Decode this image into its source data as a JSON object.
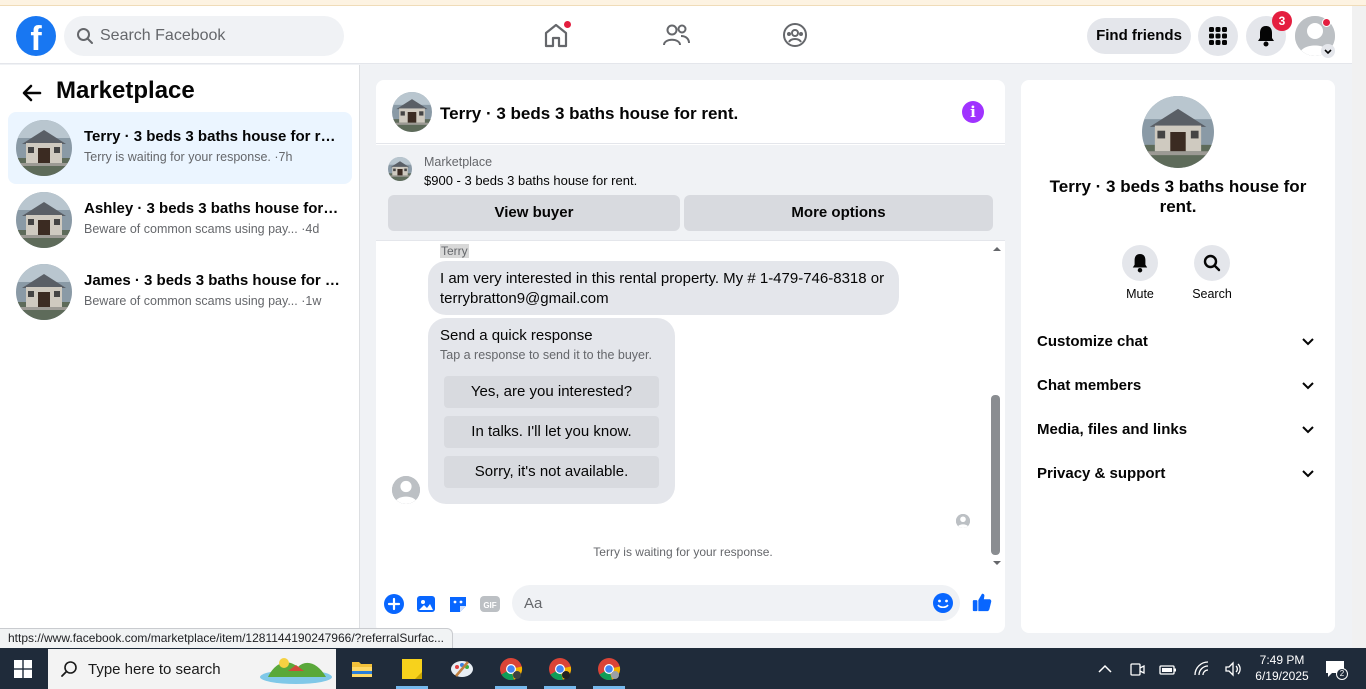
{
  "topbar": {
    "search_placeholder": "Search Facebook",
    "find_friends": "Find friends",
    "notification_count": "3"
  },
  "sidebar": {
    "title": "Marketplace",
    "conversations": [
      {
        "name": "Terry · 3 beds 3 baths house for re...",
        "preview": "Terry is waiting for your response.",
        "time": "·7h"
      },
      {
        "name": "Ashley · 3 beds 3 baths house for r...",
        "preview": "Beware of common scams using pay...",
        "time": "·4d"
      },
      {
        "name": "James · 3 beds 3 baths house for r...",
        "preview": "Beware of common scams using pay...",
        "time": "·1w"
      }
    ]
  },
  "chat": {
    "title": "Terry · 3 beds 3 baths house for rent.",
    "listing_label": "Marketplace",
    "listing_price": "$900 - 3 beds 3 baths house for rent.",
    "view_buyer": "View buyer",
    "more_options": "More options",
    "sender": "Terry",
    "message": "I am very interested in this rental property. My # 1-479-746-8318 or terrybratton9@gmail.com",
    "quick_response": {
      "heading": "Send a quick response",
      "subtext": "Tap a response to send it to the buyer.",
      "options": [
        "Yes, are you interested?",
        "In talks. I'll let you know.",
        "Sorry, it's not available."
      ]
    },
    "waiting": "Terry is waiting for your response.",
    "input_placeholder": "Aa"
  },
  "details": {
    "title": "Terry · 3 beds 3 baths house for rent.",
    "mute": "Mute",
    "search": "Search",
    "sections": [
      "Customize chat",
      "Chat members",
      "Media, files and links",
      "Privacy & support"
    ]
  },
  "status_url": "https://www.facebook.com/marketplace/item/1281144190247966/?referralSurfac...",
  "taskbar": {
    "search_placeholder": "Type here to search",
    "time": "7:49 PM",
    "date": "6/19/2025",
    "notifications": "2"
  },
  "colors": {
    "brand": "#1877f2",
    "active_row": "#ebf5ff",
    "badge": "#e41e3f",
    "info": "#a033ff"
  }
}
